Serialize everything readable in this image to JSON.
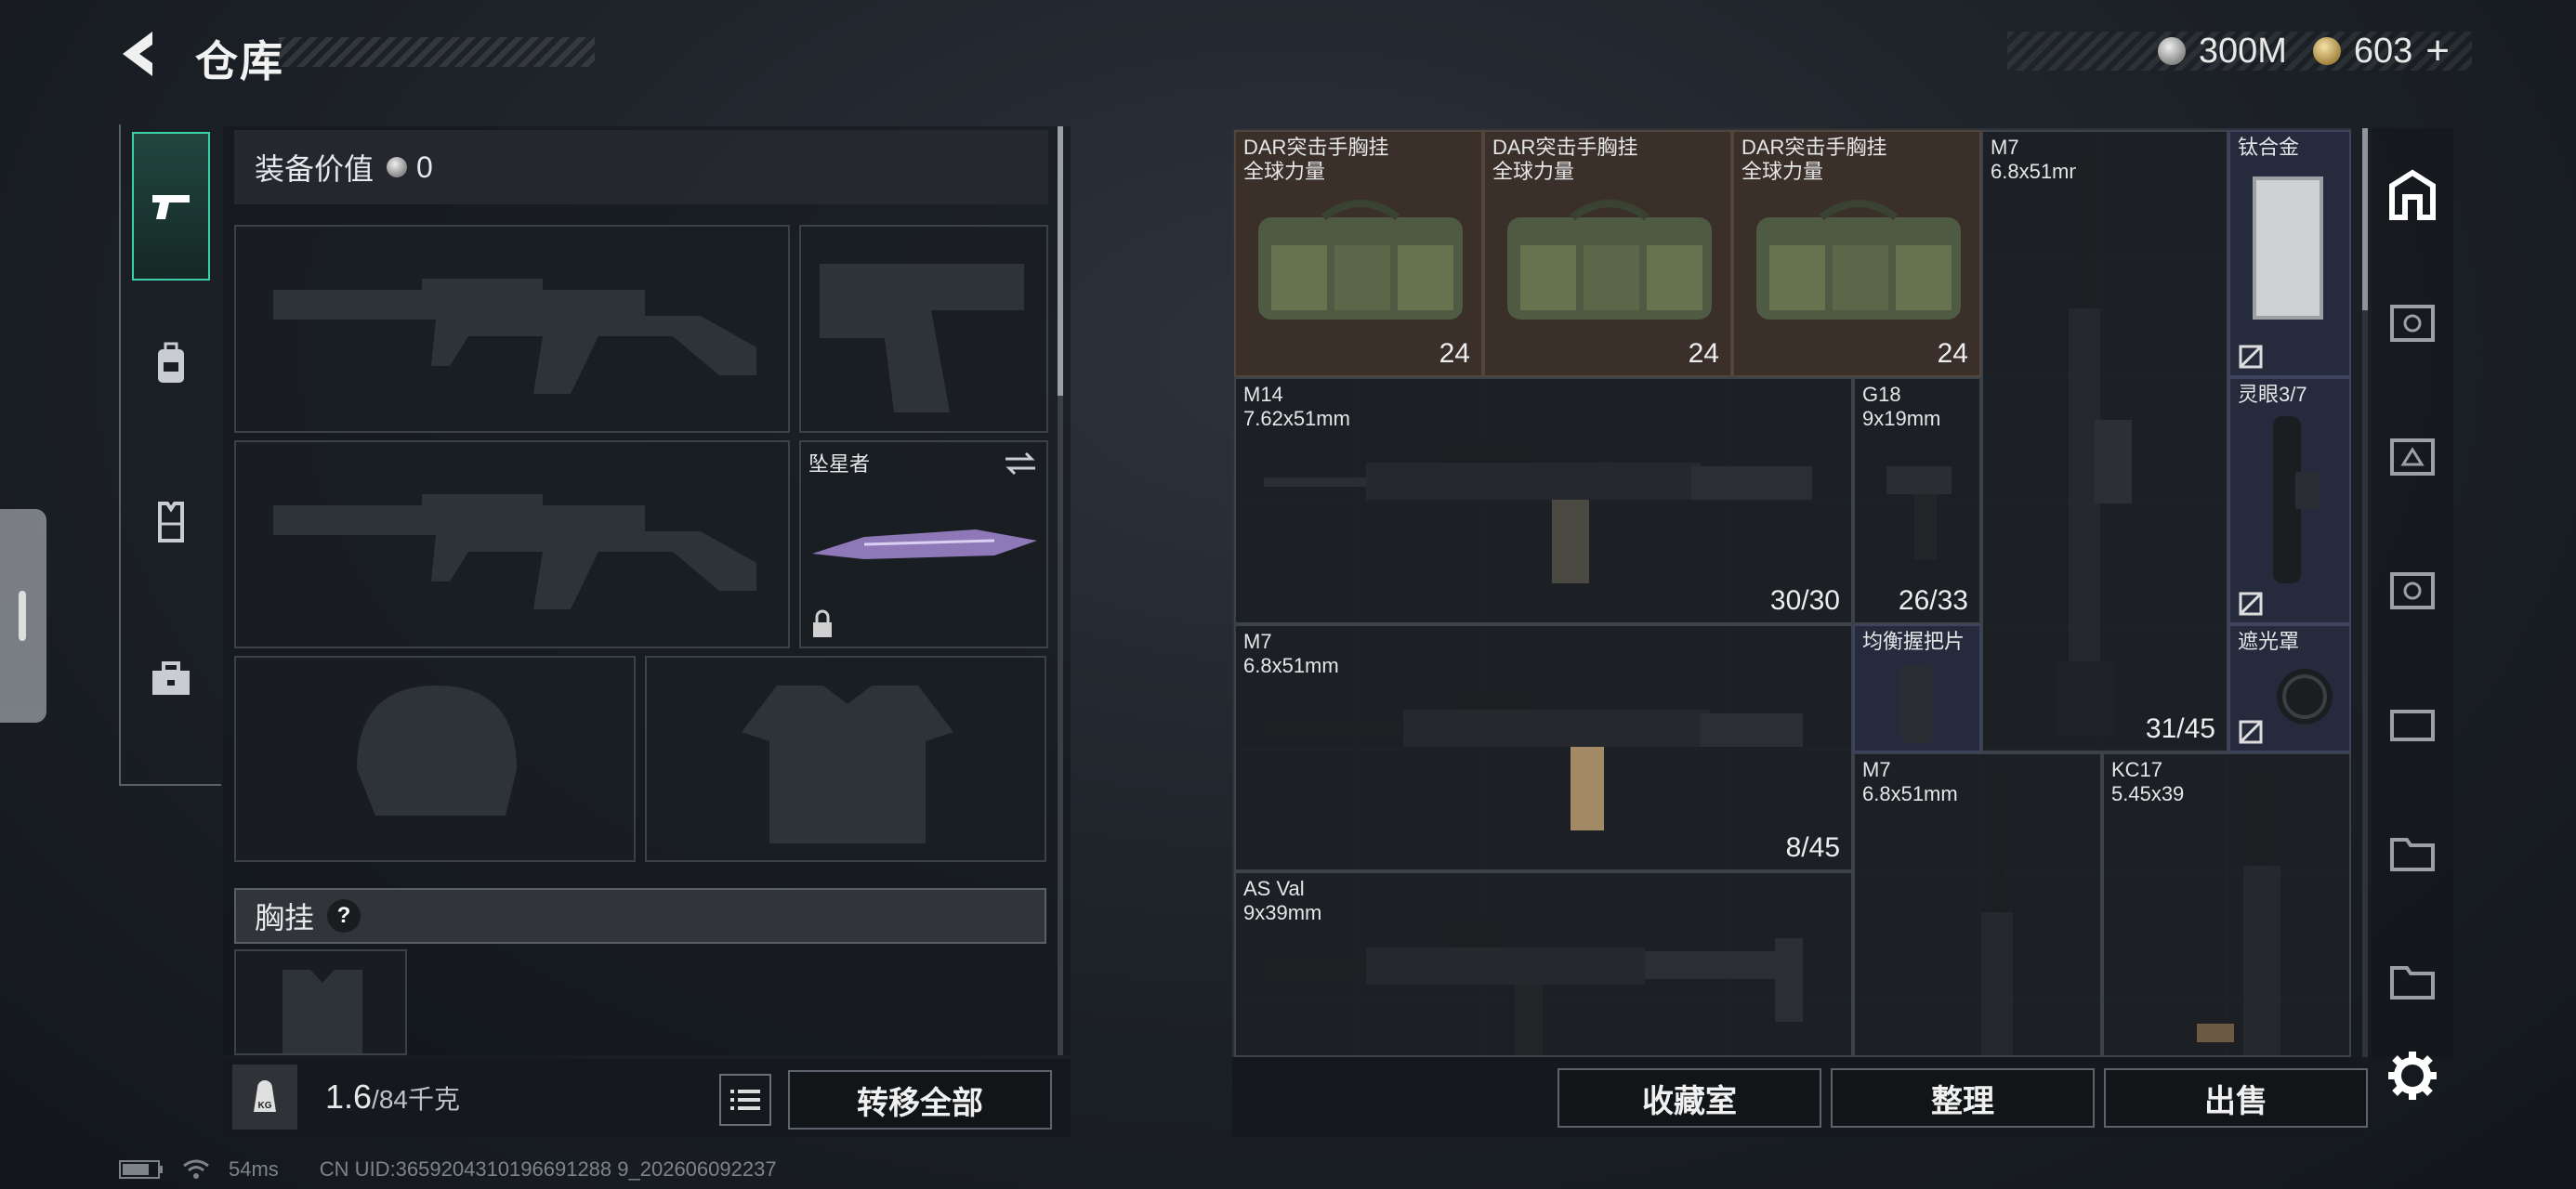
{
  "header": {
    "title": "仓库",
    "currency": [
      {
        "type": "silver-coin-icon",
        "value": "300M"
      },
      {
        "type": "gold-coin-icon",
        "value": "603"
      }
    ],
    "add_label": "+"
  },
  "equipment": {
    "value_label": "装备价值",
    "value": "0",
    "melee_name": "坠星者",
    "chest_label": "胸挂",
    "help_label": "?"
  },
  "weight": {
    "current": "1.6",
    "capacity": "/84千克",
    "kg_label": "KG"
  },
  "actions": {
    "transfer_all": "转移全部",
    "collection": "收藏室",
    "sort": "整理",
    "sell": "出售"
  },
  "storage_items": [
    {
      "name": "DAR突击手胸挂\n全球力量",
      "count": "24"
    },
    {
      "name": "DAR突击手胸挂\n全球力量",
      "count": "24"
    },
    {
      "name": "DAR突击手胸挂\n全球力量",
      "count": "24"
    },
    {
      "name": "M7\n6.8x51mm",
      "count": "31/45"
    },
    {
      "name": "钛合金",
      "count": ""
    },
    {
      "name": "M14\n7.62x51mm",
      "count": "30/30"
    },
    {
      "name": "G18\n9x19mm",
      "count": "26/33"
    },
    {
      "name": "灵眼3/7",
      "count": ""
    },
    {
      "name": "M7\n6.8x51mm",
      "count": "8/45"
    },
    {
      "name": "均衡握把片",
      "count": ""
    },
    {
      "name": "遮光罩",
      "count": ""
    },
    {
      "name": "M7\n6.8x51mm",
      "count": ""
    },
    {
      "name": "KC17\n5.45x39",
      "count": ""
    },
    {
      "name": "AS Val\n9x39mm",
      "count": ""
    }
  ],
  "status": {
    "ping": "54ms",
    "uid": "CN UID:3659204310196691288 9_202606092237"
  }
}
